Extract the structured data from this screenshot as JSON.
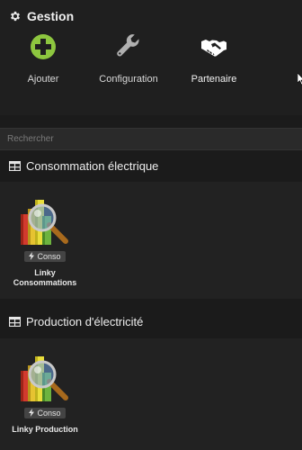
{
  "gestion": {
    "title": "Gestion",
    "actions": [
      {
        "label": "Ajouter",
        "icon": "plus-circle-icon",
        "color": "#8dc63f"
      },
      {
        "label": "Configuration",
        "icon": "wrench-icon",
        "color": "#b0b0b0"
      },
      {
        "label": "Partenaire",
        "icon": "handshake-icon",
        "color": "#ffffff"
      }
    ]
  },
  "search": {
    "placeholder": "Rechercher"
  },
  "sections": [
    {
      "title": "Consommation électrique",
      "items": [
        {
          "badge": "Conso",
          "name_line1": "Linky",
          "name_line2": "Consommations"
        }
      ]
    },
    {
      "title": "Production d'électricité",
      "items": [
        {
          "badge": "Conso",
          "name_line1": "Linky Production",
          "name_line2": ""
        }
      ]
    }
  ],
  "colors": {
    "background": "#1b1b1b",
    "panel": "#222222",
    "badge": "#444444",
    "accent": "#8dc63f"
  }
}
